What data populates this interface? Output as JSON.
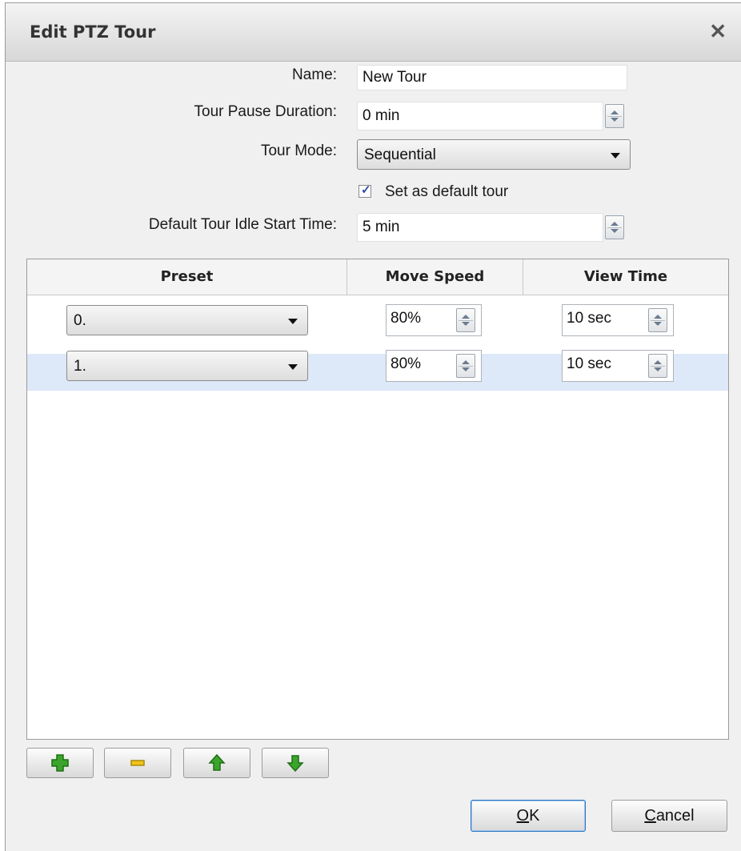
{
  "dialog": {
    "title": "Edit PTZ Tour"
  },
  "form": {
    "name_label": "Name:",
    "name_value": "New Tour",
    "pause_label": "Tour Pause Duration:",
    "pause_value": "0 min",
    "mode_label": "Tour Mode:",
    "mode_value": "Sequential",
    "default_checkbox_label": "Set as default tour",
    "default_checked": true,
    "idle_label": "Default Tour Idle Start Time:",
    "idle_value": "5 min"
  },
  "table": {
    "headers": [
      "Preset",
      "Move Speed",
      "View Time"
    ],
    "rows": [
      {
        "preset": "0.",
        "speed": "80%",
        "time": "10 sec",
        "selected": false
      },
      {
        "preset": "1.",
        "speed": "80%",
        "time": "10 sec",
        "selected": true
      }
    ]
  },
  "toolbar": {
    "icons": [
      "add-icon",
      "remove-icon",
      "move-up-icon",
      "move-down-icon"
    ]
  },
  "buttons": {
    "ok_mnemonic": "O",
    "ok_rest": "K",
    "cancel_mnemonic": "C",
    "cancel_rest": "ancel"
  },
  "colors": {
    "selected_row": "#dde8f8",
    "toolbar_icon_green": "#3aa52a",
    "toolbar_icon_yellow": "#f2c417"
  }
}
